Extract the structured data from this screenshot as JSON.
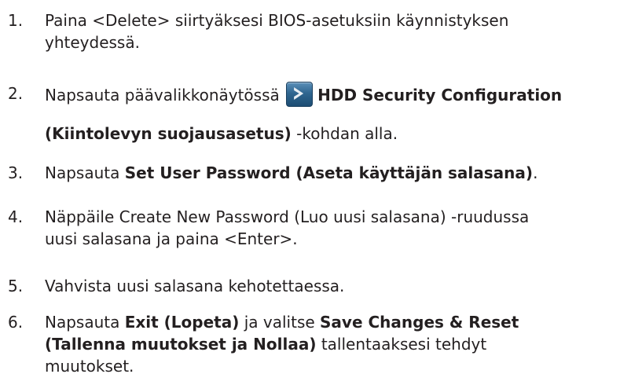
{
  "steps": [
    {
      "number": "1.",
      "line1": "Paina <Delete> siirtyäksesi BIOS-asetuksiin käynnistyksen",
      "line2": "yhteydessä."
    },
    {
      "number": "2.",
      "pre": "Napsauta päävalikkonäytössä",
      "icon": "arrow-right-icon",
      "bold1": "HDD Security Configuration",
      "bold2": "(Kiintolevyn suojausasetus)",
      "post": " -kohdan alla."
    },
    {
      "number": "3.",
      "pre": "Napsauta ",
      "bold": "Set User Password (Aseta käyttäjän salasana)",
      "post": "."
    },
    {
      "number": "4.",
      "line1": "Näppäile Create New Password (Luo uusi salasana) -ruudussa",
      "line2": "uusi salasana ja paina <Enter>."
    },
    {
      "number": "5.",
      "text": "Vahvista uusi salasana kehotettaessa."
    },
    {
      "number": "6.",
      "pre": "Napsauta ",
      "bold_a": "Exit (Lopeta)",
      "mid": " ja valitse ",
      "bold_b1": "Save Changes & Reset",
      "bold_b2": "(Tallenna muutokset ja Nollaa)",
      "post1": " tallentaaksesi tehdyt",
      "post2": "muutokset."
    }
  ]
}
